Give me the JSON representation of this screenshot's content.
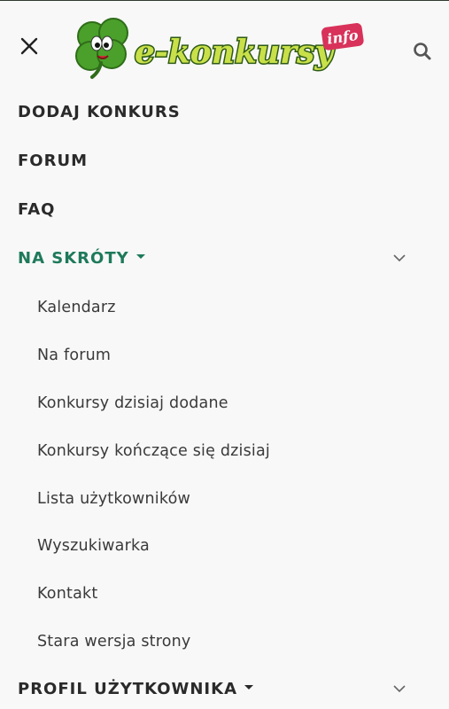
{
  "header": {
    "logo_text": "e-konkursy",
    "logo_badge": "info"
  },
  "menu": {
    "items": [
      {
        "label": "DODAJ KONKURS"
      },
      {
        "label": "FORUM"
      },
      {
        "label": "FAQ"
      },
      {
        "label": "NA SKRÓTY",
        "expanded": true
      },
      {
        "label": "PROFIL UŻYTKOWNIKA",
        "expanded": false
      }
    ],
    "submenu": [
      {
        "label": "Kalendarz"
      },
      {
        "label": "Na forum"
      },
      {
        "label": "Konkursy dzisiaj dodane"
      },
      {
        "label": "Konkursy kończące się dzisiaj"
      },
      {
        "label": "Lista użytkowników"
      },
      {
        "label": "Wyszukiwarka"
      },
      {
        "label": "Kontakt"
      },
      {
        "label": "Stara wersja strony"
      }
    ]
  },
  "colors": {
    "active": "#1e7a5a",
    "text": "#2a2a2a",
    "background": "#f8f8f8"
  },
  "icons": {
    "close": "close-icon",
    "search": "search-icon",
    "chevron": "chevron-down-icon",
    "caret": "caret-down-icon",
    "logo": "clover-logo"
  }
}
